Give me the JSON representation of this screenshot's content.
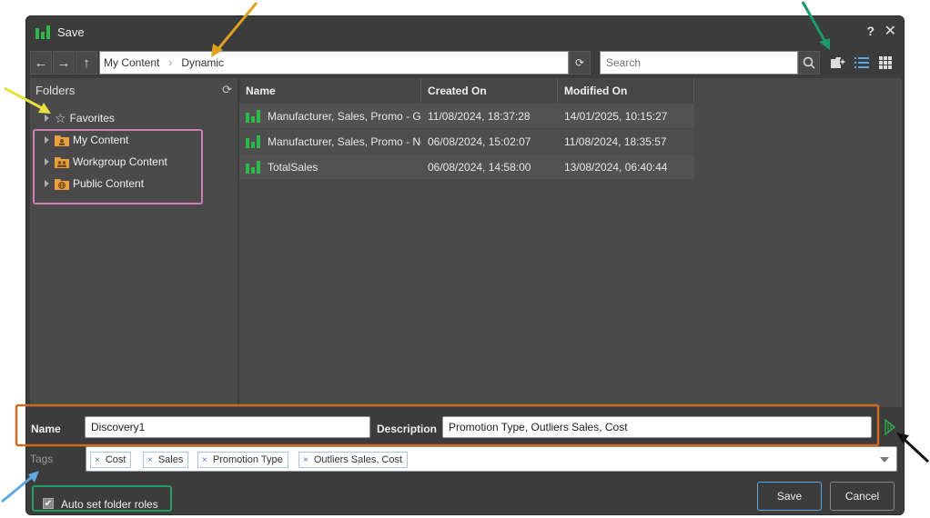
{
  "window": {
    "title": "Save",
    "help_label": "?",
    "close_label": "✕"
  },
  "navbar": {
    "back": "←",
    "forward": "→",
    "up": "↑",
    "path": [
      "My Content",
      "Dynamic"
    ],
    "path_separator": "›",
    "refresh": "⟳",
    "search_placeholder": "Search"
  },
  "folders": {
    "header": "Folders",
    "refresh": "⟳",
    "items": [
      {
        "label": "Favorites",
        "icon": "star-icon"
      },
      {
        "label": "My Content",
        "icon": "user-folder-icon"
      },
      {
        "label": "Workgroup Content",
        "icon": "group-folder-icon"
      },
      {
        "label": "Public Content",
        "icon": "globe-folder-icon"
      }
    ]
  },
  "filelist": {
    "columns": [
      "Name",
      "Created On",
      "Modified On"
    ],
    "rows": [
      {
        "name": "Manufacturer, Sales, Promo - Gr",
        "created": "11/08/2024, 18:37:28",
        "modified": "14/01/2025, 10:15:27"
      },
      {
        "name": "Manufacturer, Sales, Promo - No",
        "created": "06/08/2024, 15:02:07",
        "modified": "11/08/2024, 18:35:57"
      },
      {
        "name": "TotalSales",
        "created": "06/08/2024, 14:58:00",
        "modified": "13/08/2024, 06:40:44"
      }
    ]
  },
  "form": {
    "name_label": "Name",
    "name_value": "Discovery1",
    "description_label": "Description",
    "description_value": "Promotion Type, Outliers Sales, Cost",
    "tags_label": "Tags",
    "tags": [
      "Cost",
      "Sales",
      "Promotion Type",
      "Outliers Sales, Cost"
    ],
    "tag_remove": "×",
    "auto_roles_label": "Auto set folder roles",
    "auto_roles_checked": "✔",
    "save_label": "Save",
    "cancel_label": "Cancel"
  },
  "colors": {
    "accent_green": "#2db84a",
    "folder_orange": "#e8a040",
    "annot_orange": "#e0a020",
    "annot_teal": "#1a9a6a",
    "annot_yellow": "#e8e040",
    "annot_pink": "#d080b0",
    "annot_rust": "#d06a20",
    "annot_blue": "#60a8e0",
    "annot_green": "#20a060"
  }
}
